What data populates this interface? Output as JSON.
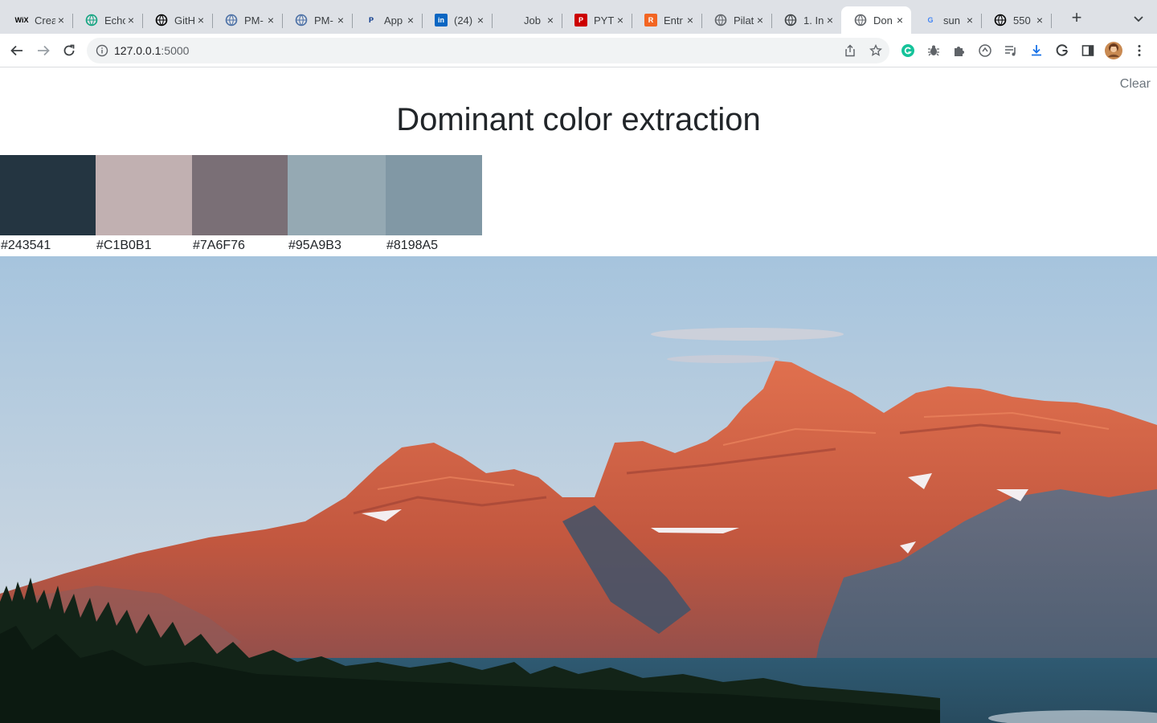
{
  "browser": {
    "tabs": [
      {
        "title": "Crea",
        "icon": "wix-icon",
        "favicon_text": "WiX",
        "favicon_color": "#000000"
      },
      {
        "title": "Echo",
        "icon": "chatgpt-icon",
        "favicon_text": "",
        "favicon_color": "#10a37f"
      },
      {
        "title": "GitH",
        "icon": "github-icon",
        "favicon_text": "",
        "favicon_color": "#000000"
      },
      {
        "title": "PM-",
        "icon": "globe-icon",
        "favicon_text": "",
        "favicon_color": "#4a6fa5"
      },
      {
        "title": "PM-",
        "icon": "globe-icon",
        "favicon_text": "",
        "favicon_color": "#4a6fa5"
      },
      {
        "title": "App",
        "icon": "paypal-icon",
        "favicon_text": "P",
        "favicon_color": "#003087"
      },
      {
        "title": "(24)",
        "icon": "linkedin-icon",
        "favicon_text": "in",
        "favicon_color": "#0a66c2"
      },
      {
        "title": "Job",
        "icon": "blank-icon",
        "favicon_text": "",
        "favicon_color": "#dee1e6"
      },
      {
        "title": "PYT",
        "icon": "pyt-icon",
        "favicon_text": "P",
        "favicon_color": "#cc0000"
      },
      {
        "title": "Entr",
        "icon": "r-icon",
        "favicon_text": "R",
        "favicon_color": "#f26522"
      },
      {
        "title": "Pilat",
        "icon": "pilates-icon",
        "favicon_text": "",
        "favicon_color": "#5f6368"
      },
      {
        "title": "1. In",
        "icon": "doc-icon",
        "favicon_text": "",
        "favicon_color": "#3c4043"
      },
      {
        "title": "Don",
        "icon": "globe-icon",
        "favicon_text": "",
        "favicon_color": "#5f6368",
        "active": true
      },
      {
        "title": "sun",
        "icon": "google-icon",
        "favicon_text": "G",
        "favicon_color": "#4285f4"
      },
      {
        "title": "550",
        "icon": "unsplash-icon",
        "favicon_text": "",
        "favicon_color": "#000000"
      }
    ],
    "url_host": "127.0.0.1",
    "url_port": ":5000"
  },
  "page": {
    "clear_label": "Clear",
    "title": "Dominant color extraction",
    "swatches": [
      {
        "hex": "#243541",
        "label": "#243541"
      },
      {
        "hex": "#C1B0B1",
        "label": "#C1B0B1"
      },
      {
        "hex": "#7A6F76",
        "label": "#7A6F76"
      },
      {
        "hex": "#95A9B3",
        "label": "#95A9B3"
      },
      {
        "hex": "#8198A5",
        "label": "#8198A5"
      }
    ]
  }
}
